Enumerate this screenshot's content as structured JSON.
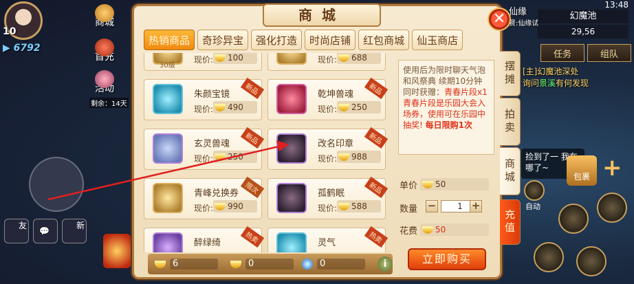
{
  "player": {
    "level": "10",
    "power": "6792"
  },
  "hud": {
    "left_buttons": [
      {
        "label": "商城"
      },
      {
        "label": "首充"
      },
      {
        "label": "活动",
        "note": "剩余：14天"
      }
    ],
    "xianyuan": "仙缘",
    "xianyuan_sub": "贤:仙缘试",
    "time": "13:48",
    "map_name": "幻魔池",
    "coords": "29,56",
    "task_tab": "任务",
    "team_tab": "组队",
    "quest_title": "[主]幻魔池深处",
    "quest_text_a": "询问",
    "quest_text_hl": "景溪",
    "quest_text_b": "有何发现",
    "chat_text": "捡到了一 我在哪了~",
    "auto": "自动",
    "bag": "包裹",
    "bottom_buttons": [
      "友",
      "",
      "新"
    ]
  },
  "shop": {
    "title": "商城",
    "close": "✕",
    "tabs": [
      "热销商品",
      "奇珍异宝",
      "强化打造",
      "时尚店铺",
      "红包商城",
      "仙玉商店"
    ],
    "active_tab": 0,
    "price_label": "现价:",
    "items": [
      {
        "name": "",
        "price": "100",
        "badge": "",
        "thumb": "gold",
        "sub": "30级"
      },
      {
        "name": "",
        "price": "688",
        "badge": "",
        "thumb": "gold",
        "sub": ""
      },
      {
        "name": "朱颜宝镜",
        "price": "490",
        "badge": "新品",
        "thumb": "cyan",
        "sub": ""
      },
      {
        "name": "乾坤兽魂",
        "price": "250",
        "badge": "新品",
        "thumb": "red",
        "sub": ""
      },
      {
        "name": "玄灵兽魂",
        "price": "250",
        "badge": "新品",
        "thumb": "",
        "sub": ""
      },
      {
        "name": "改名印章",
        "price": "988",
        "badge": "新品",
        "thumb": "dark",
        "sub": ""
      },
      {
        "name": "青峰兑换券",
        "price": "990",
        "badge": "限次",
        "thumb": "gold",
        "sub": ""
      },
      {
        "name": "孤鹤眠",
        "price": "588",
        "badge": "新品",
        "thumb": "dark",
        "sub": ""
      },
      {
        "name": "醉绿绮",
        "price": "",
        "badge": "热卖",
        "thumb": "violet",
        "sub": ""
      },
      {
        "name": "灵气",
        "price": "",
        "badge": "热卖",
        "thumb": "cyan",
        "sub": ""
      }
    ],
    "description": {
      "line1": "使用后为限时聊天气泡和风祭典 续期10分钟",
      "line2a": "同时获赠：",
      "line2b": "青春片段x1",
      "line3": "青春片段是乐园大会入场券，使用可在乐园中抽奖!",
      "line4": "每日限购1次"
    },
    "unit_price_label": "单价",
    "unit_price": "50",
    "quantity_label": "数量",
    "quantity": "1",
    "cost_label": "花费",
    "cost": "50",
    "buy_button": "立即购买",
    "balances": [
      "6",
      "0",
      "0"
    ],
    "info": "i",
    "side_tabs": [
      "摆摊",
      "拍卖",
      "商城",
      "充值"
    ]
  },
  "colors": {
    "accent": "#f08a10",
    "panel": "#f6ead2",
    "border": "#b07a3e",
    "price_red": "#e0301a"
  }
}
